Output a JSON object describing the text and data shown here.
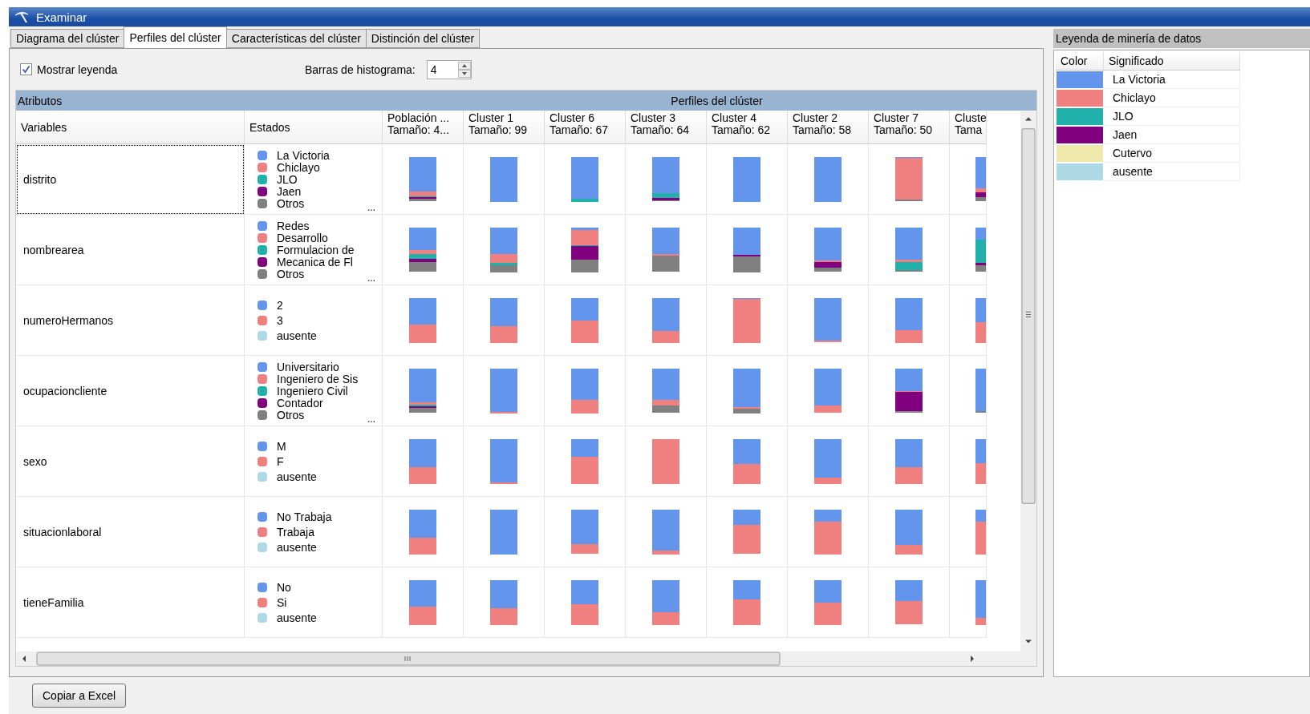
{
  "window": {
    "title": "Examinar"
  },
  "tabs": [
    {
      "label": "Diagrama del clúster",
      "selected": false
    },
    {
      "label": "Perfiles del clúster",
      "selected": true
    },
    {
      "label": "Características del clúster",
      "selected": false
    },
    {
      "label": "Distinción del clúster",
      "selected": false
    }
  ],
  "options": {
    "show_legend": {
      "label": "Mostrar leyenda",
      "checked": true
    },
    "histogram_bars": {
      "label": "Barras de histograma:",
      "value": "4"
    }
  },
  "profiles": {
    "band": {
      "attributes": "Atributos",
      "title": "Perfiles del clúster"
    },
    "columns": {
      "variables": "Variables",
      "states": "Estados",
      "clusters": [
        {
          "name": "Población ...",
          "size": "Tamaño: 4..."
        },
        {
          "name": "Cluster 1",
          "size": "Tamaño: 99"
        },
        {
          "name": "Cluster 6",
          "size": "Tamaño: 67"
        },
        {
          "name": "Cluster 3",
          "size": "Tamaño: 64"
        },
        {
          "name": "Cluster 4",
          "size": "Tamaño: 62"
        },
        {
          "name": "Cluster 2",
          "size": "Tamaño: 58"
        },
        {
          "name": "Cluster 7",
          "size": "Tamaño: 50"
        },
        {
          "name": "Cluste",
          "size": "Tama"
        }
      ]
    },
    "rows": [
      {
        "variable": "distrito",
        "focused": true,
        "more": "...",
        "states": [
          {
            "label": "La Victoria",
            "color": "#6495ed"
          },
          {
            "label": "Chiclayo",
            "color": "#f08080"
          },
          {
            "label": "JLO",
            "color": "#20b2aa"
          },
          {
            "label": "Jaen",
            "color": "#800080"
          },
          {
            "label": "Otros",
            "color": "#808080"
          }
        ]
      },
      {
        "variable": "nombrearea",
        "focused": false,
        "more": "...",
        "states": [
          {
            "label": "Redes",
            "color": "#6495ed"
          },
          {
            "label": "Desarrollo",
            "color": "#f08080"
          },
          {
            "label": "Formulacion de",
            "color": "#20b2aa"
          },
          {
            "label": "Mecanica de Fl",
            "color": "#800080"
          },
          {
            "label": "Otros",
            "color": "#808080"
          }
        ]
      },
      {
        "variable": "numeroHermanos",
        "focused": false,
        "states": [
          {
            "label": "2",
            "color": "#6495ed"
          },
          {
            "label": "3",
            "color": "#f08080"
          },
          {
            "label": "ausente",
            "color": "#add8e6"
          }
        ]
      },
      {
        "variable": "ocupacioncliente",
        "focused": false,
        "more": "...",
        "states": [
          {
            "label": "Universitario",
            "color": "#6495ed"
          },
          {
            "label": "Ingeniero de Sis",
            "color": "#f08080"
          },
          {
            "label": "Ingeniero Civil",
            "color": "#20b2aa"
          },
          {
            "label": "Contador",
            "color": "#800080"
          },
          {
            "label": "Otros",
            "color": "#808080"
          }
        ]
      },
      {
        "variable": "sexo",
        "focused": false,
        "states": [
          {
            "label": "M",
            "color": "#6495ed"
          },
          {
            "label": "F",
            "color": "#f08080"
          },
          {
            "label": "ausente",
            "color": "#add8e6"
          }
        ]
      },
      {
        "variable": "situacionlaboral",
        "focused": false,
        "states": [
          {
            "label": "No Trabaja",
            "color": "#6495ed"
          },
          {
            "label": "Trabaja",
            "color": "#f08080"
          },
          {
            "label": "ausente",
            "color": "#add8e6"
          }
        ]
      },
      {
        "variable": "tieneFamilia",
        "focused": false,
        "states": [
          {
            "label": "No",
            "color": "#6495ed"
          },
          {
            "label": "Si",
            "color": "#f08080"
          },
          {
            "label": "ausente",
            "color": "#add8e6"
          }
        ]
      }
    ]
  },
  "legend": {
    "title": "Leyenda de minería de datos",
    "columns": [
      "Color",
      "Significado"
    ],
    "items": [
      {
        "label": "La Victoria",
        "color": "#6495ed"
      },
      {
        "label": "Chiclayo",
        "color": "#f08080"
      },
      {
        "label": "JLO",
        "color": "#20b2aa"
      },
      {
        "label": "Jaen",
        "color": "#800080"
      },
      {
        "label": "Cutervo",
        "color": "#eee8aa"
      },
      {
        "label": "ausente",
        "color": "#add8e6"
      }
    ]
  },
  "buttons": [
    {
      "label": "Copiar a Excel"
    }
  ]
}
